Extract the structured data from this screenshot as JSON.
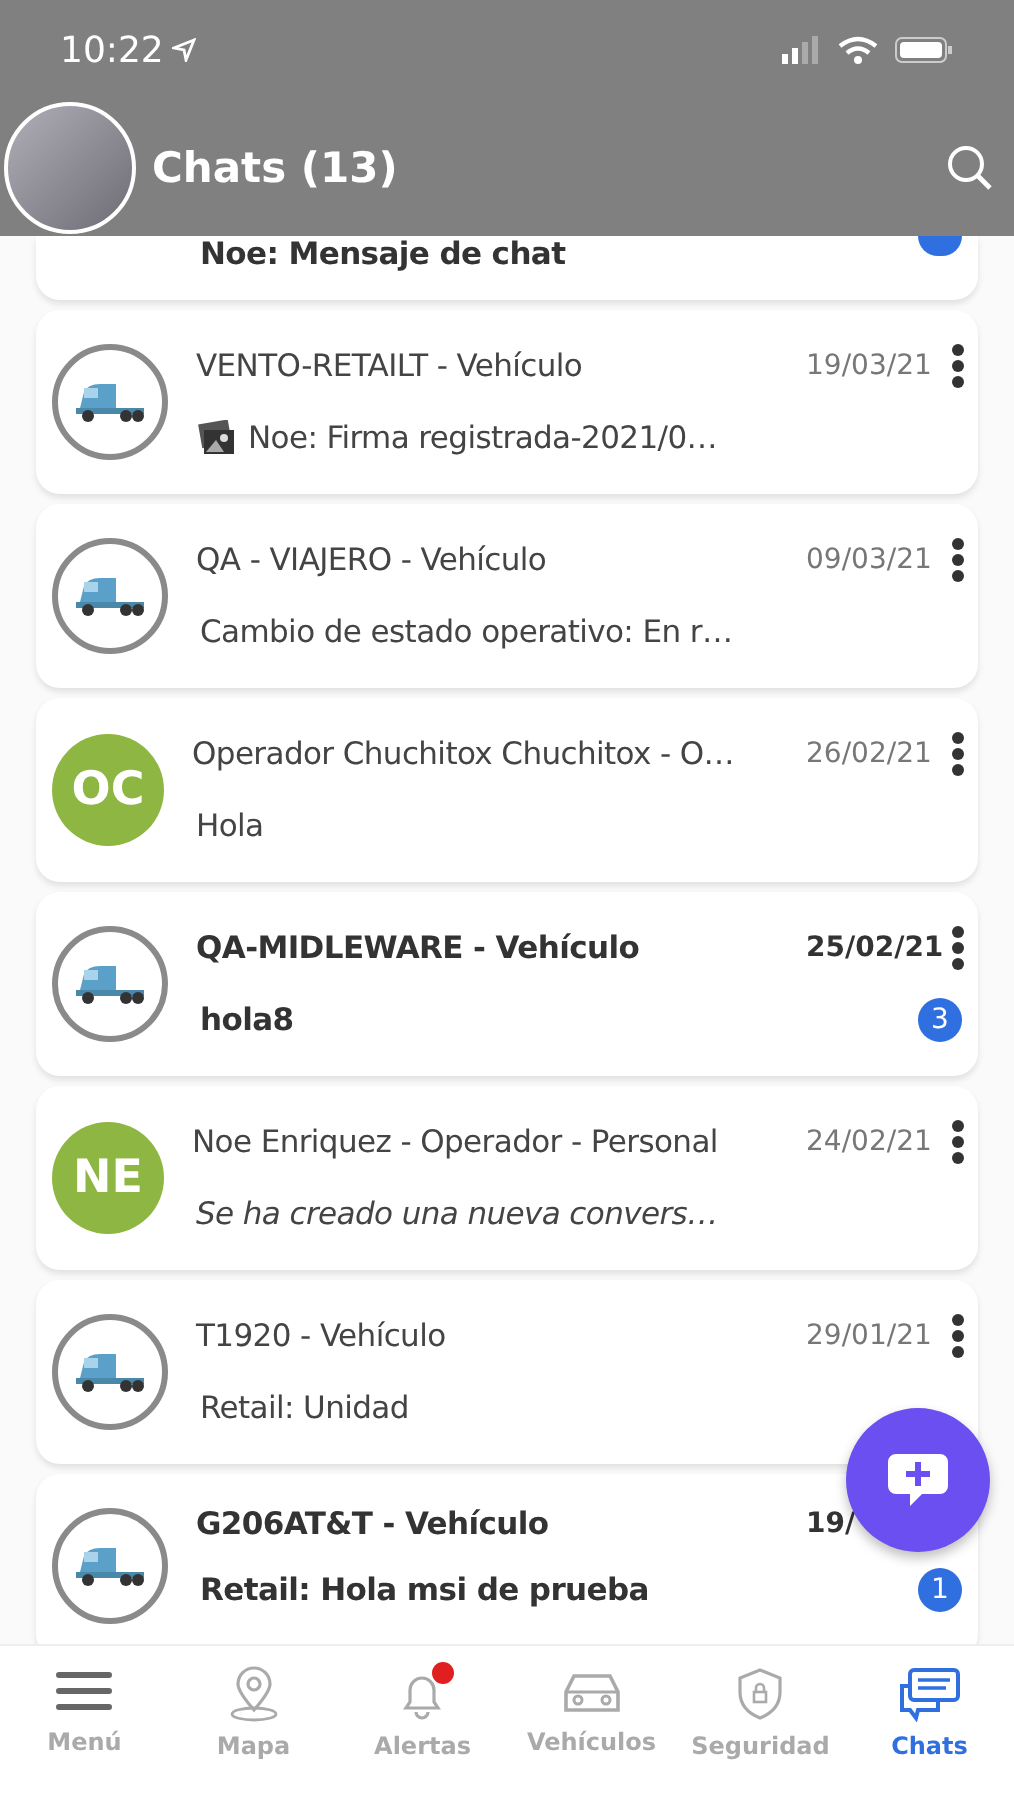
{
  "status_bar": {
    "time": "10:22"
  },
  "header": {
    "title": "Chats (13)"
  },
  "previous_chat": {
    "preview": "Noe: Mensaje de chat",
    "unread": true
  },
  "chats": [
    {
      "avatar": {
        "kind": "vehicle"
      },
      "name": "VENTO-RETAILT - Vehículo",
      "date": "19/03/21",
      "preview": "Noe: Firma registrada-2021/0…",
      "attachment": true,
      "unread": false,
      "italic": false
    },
    {
      "avatar": {
        "kind": "vehicle"
      },
      "name": "QA - VIAJERO - Vehículo",
      "date": "09/03/21",
      "preview": "Cambio de estado operativo: En r…",
      "attachment": false,
      "unread": false,
      "italic": false
    },
    {
      "avatar": {
        "kind": "initials",
        "initials": "OC",
        "color": "#8db642"
      },
      "name": "Operador Chuchitox Chuchitox - O…",
      "date": "26/02/21",
      "preview": "Hola",
      "attachment": false,
      "unread": false,
      "italic": false
    },
    {
      "avatar": {
        "kind": "vehicle"
      },
      "name": "QA-MIDLEWARE - Vehículo",
      "date": "25/02/21",
      "preview": "hola8",
      "attachment": false,
      "unread": true,
      "badge": "3",
      "italic": false
    },
    {
      "avatar": {
        "kind": "initials",
        "initials": "NE",
        "color": "#8db642"
      },
      "name": "Noe Enriquez - Operador - Personal",
      "date": "24/02/21",
      "preview": "Se ha creado una nueva convers…",
      "attachment": false,
      "unread": false,
      "italic": true
    },
    {
      "avatar": {
        "kind": "vehicle"
      },
      "name": "T1920 - Vehículo",
      "date": "29/01/21",
      "preview": "Retail: Unidad",
      "attachment": false,
      "unread": false,
      "italic": false
    },
    {
      "avatar": {
        "kind": "vehicle"
      },
      "name": "G206AT&T - Vehículo",
      "date": "19/",
      "preview": "Retail: Hola msi de prueba",
      "attachment": false,
      "unread": true,
      "badge": "1",
      "italic": false
    }
  ],
  "tabs": [
    {
      "label": "Menú",
      "selected": false,
      "alert": false
    },
    {
      "label": "Mapa",
      "selected": false,
      "alert": false
    },
    {
      "label": "Alertas",
      "selected": false,
      "alert": true
    },
    {
      "label": "Vehículos",
      "selected": false,
      "alert": false
    },
    {
      "label": "Seguridad",
      "selected": false,
      "alert": false
    },
    {
      "label": "Chats",
      "selected": true,
      "alert": false
    }
  ]
}
